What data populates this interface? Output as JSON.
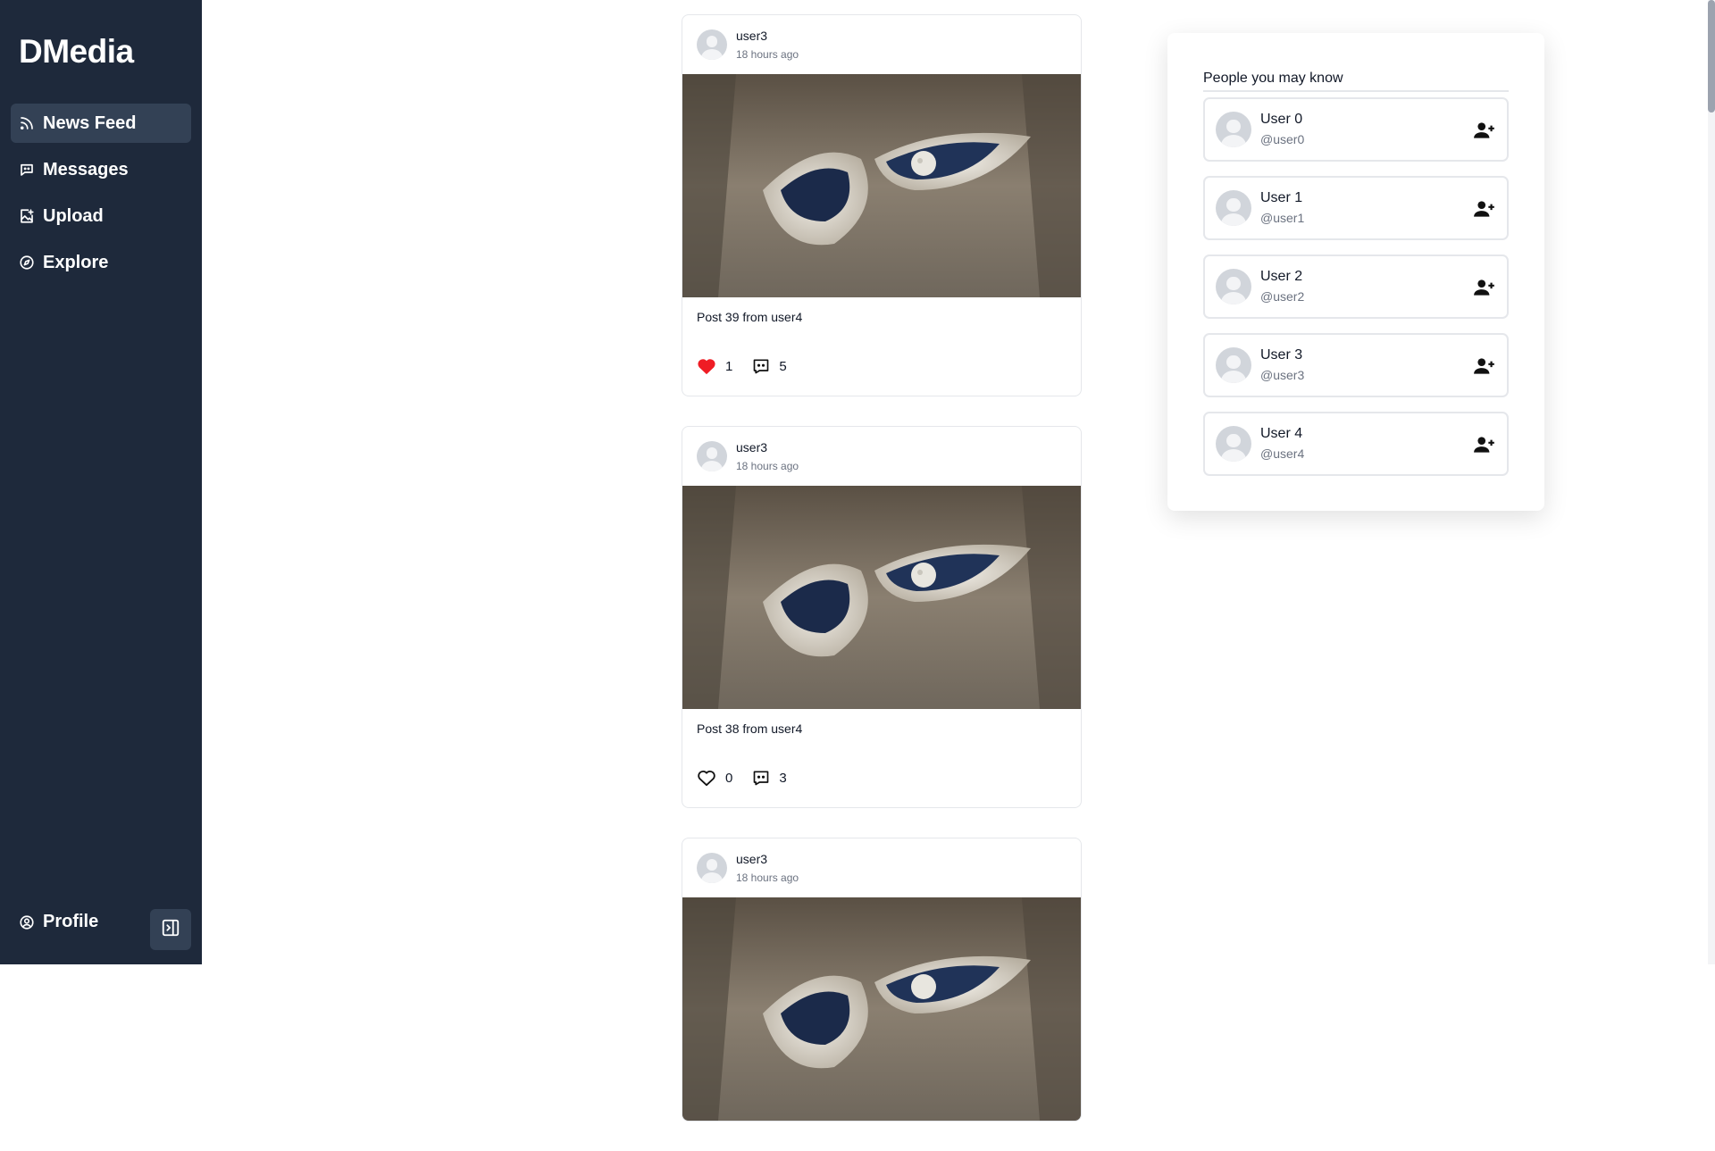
{
  "app": {
    "brand": "DMedia"
  },
  "sidebar": {
    "items": [
      {
        "label": "News Feed",
        "icon": "rss-icon",
        "active": true
      },
      {
        "label": "Messages",
        "icon": "message-icon",
        "active": false
      },
      {
        "label": "Upload",
        "icon": "image-upload-icon",
        "active": false
      },
      {
        "label": "Explore",
        "icon": "compass-icon",
        "active": false
      }
    ],
    "profile_label": "Profile"
  },
  "feed": {
    "posts": [
      {
        "user": "user3",
        "time": "18 hours ago",
        "caption": "Post 39 from user4",
        "likes": "1",
        "comments": "5",
        "liked": true
      },
      {
        "user": "user3",
        "time": "18 hours ago",
        "caption": "Post 38 from user4",
        "likes": "0",
        "comments": "3",
        "liked": false
      },
      {
        "user": "user3",
        "time": "18 hours ago",
        "caption": "",
        "likes": "",
        "comments": "",
        "liked": false
      }
    ]
  },
  "suggestions": {
    "title": "People you may know",
    "users": [
      {
        "name": "User 0",
        "handle": "@user0"
      },
      {
        "name": "User 1",
        "handle": "@user1"
      },
      {
        "name": "User 2",
        "handle": "@user2"
      },
      {
        "name": "User 3",
        "handle": "@user3"
      },
      {
        "name": "User 4",
        "handle": "@user4"
      }
    ]
  },
  "colors": {
    "sidebar_bg": "#1e293b",
    "active_item": "#334155",
    "like_red": "#ef1c24"
  }
}
